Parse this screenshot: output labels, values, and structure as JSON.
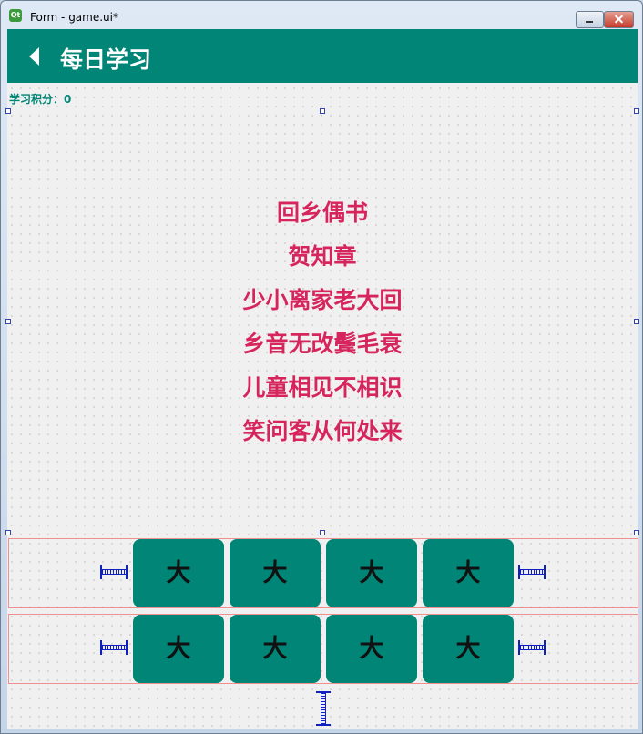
{
  "window": {
    "title": "Form - game.ui*",
    "app_icon": "qt-icon"
  },
  "header": {
    "title": "每日学习",
    "back_icon": "back-arrow-icon"
  },
  "score": {
    "label": "学习积分：0"
  },
  "poem": {
    "lines": [
      "回乡偶书",
      "贺知章",
      "少小离家老大回",
      "乡音无改鬓毛衰",
      "儿童相见不相识",
      "笑问客从何处来"
    ]
  },
  "choices": {
    "row1": [
      "大",
      "大",
      "大",
      "大"
    ],
    "row2": [
      "大",
      "大",
      "大",
      "大"
    ]
  },
  "colors": {
    "accent": "#008576",
    "poem_text": "#d6245c"
  }
}
